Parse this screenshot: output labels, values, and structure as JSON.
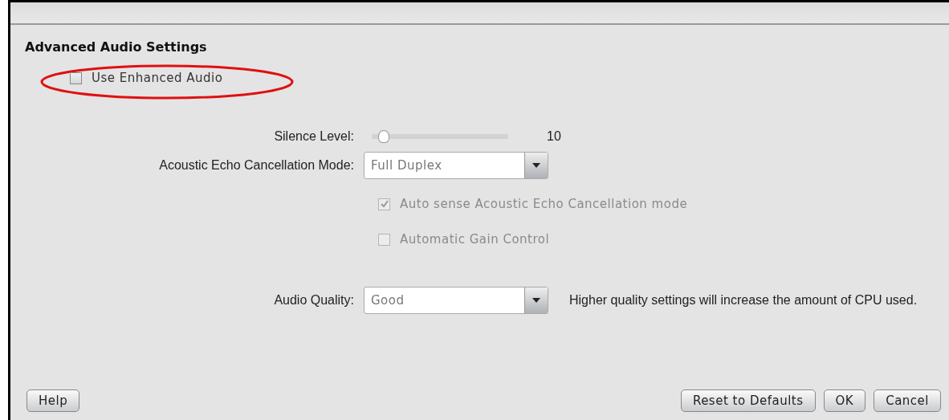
{
  "title": "Advanced Audio Settings",
  "enhanced": {
    "label": "Use Enhanced Audio",
    "checked": false,
    "highlighted": true
  },
  "silence": {
    "label": "Silence Level:",
    "level": 0.08,
    "reading": "10"
  },
  "echo": {
    "label": "Acoustic Echo Cancellation Mode:",
    "value": "Full Duplex"
  },
  "options": [
    {
      "label": "Auto sense Acoustic Echo Cancellation mode",
      "checked": true,
      "disabled": true
    },
    {
      "label": "Automatic Gain Control",
      "checked": false,
      "disabled": true
    }
  ],
  "quality": {
    "label": "Audio Quality:",
    "value": "Good",
    "note": "Higher quality settings will increase the amount of CPU used."
  },
  "buttons": {
    "left": [
      "Help"
    ],
    "right": [
      "Reset to Defaults",
      "OK",
      "Cancel"
    ]
  }
}
